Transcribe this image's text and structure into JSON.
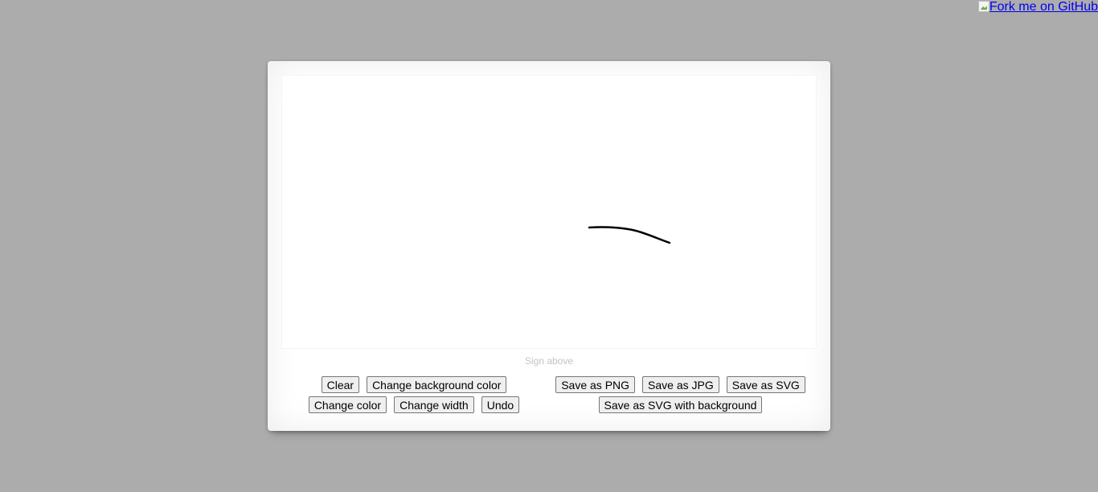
{
  "fork_link": {
    "label": "Fork me on GitHub"
  },
  "signature_pad": {
    "hint": "Sign above",
    "stroke_color": "#000000",
    "background_color": "#ffffff"
  },
  "actions_left": {
    "clear": "Clear",
    "change_background_color": "Change background color",
    "change_color": "Change color",
    "change_width": "Change width",
    "undo": "Undo"
  },
  "actions_right": {
    "save_png": "Save as PNG",
    "save_jpg": "Save as JPG",
    "save_svg": "Save as SVG",
    "save_svg_background": "Save as SVG with background"
  }
}
